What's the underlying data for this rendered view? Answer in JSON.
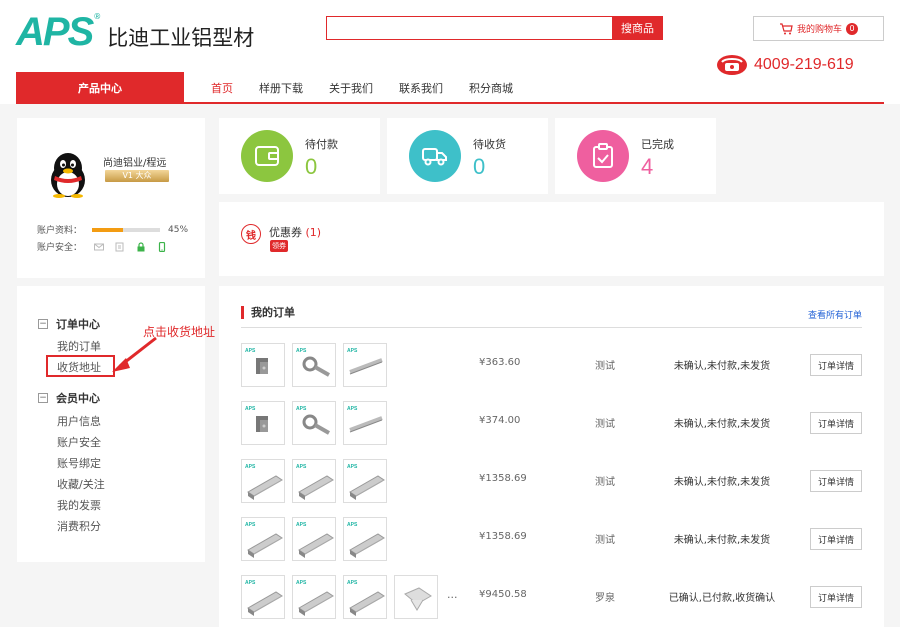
{
  "header": {
    "logo_mark": "APS",
    "logo_reg": "®",
    "logo_text": "比迪工业铝型材",
    "search_placeholder": "",
    "search_button": "搜商品",
    "cart_label": "我的购物车",
    "cart_count": "0",
    "phone": "4009-219-619"
  },
  "nav": {
    "product_center": "产品中心",
    "items": [
      "首页",
      "样册下载",
      "关于我们",
      "联系我们",
      "积分商城"
    ]
  },
  "profile": {
    "username": "尚迪铝业/程远",
    "vip_label": "V1 大众",
    "account_info_label": "账户资料：",
    "account_info_percent": "45%",
    "account_info_progress": 0.45,
    "account_security_label": "账户安全："
  },
  "stats": [
    {
      "label": "待付款",
      "value": "0",
      "color": "#8cc63f"
    },
    {
      "label": "待收货",
      "value": "0",
      "color": "#3ec0c9"
    },
    {
      "label": "已完成",
      "value": "4",
      "color": "#ef5f9f"
    }
  ],
  "coupon": {
    "icon_text": "钱",
    "label": "优惠券",
    "count": "(1)",
    "button": "领券"
  },
  "menu": {
    "order_center": "订单中心",
    "order_items": [
      "我的订单",
      "收货地址"
    ],
    "member_center": "会员中心",
    "member_items": [
      "用户信息",
      "账户安全",
      "账号绑定",
      "收藏/关注",
      "我的发票",
      "消费积分"
    ],
    "collapse_symbol": "−"
  },
  "annotation": "点击收货地址",
  "orders": {
    "title": "我的订单",
    "view_all": "查看所有订单",
    "detail_label": "订单详情",
    "rows": [
      {
        "price": "¥363.60",
        "note": "测试",
        "status": "未确认,未付款,未发货",
        "thumbs": [
          "bracket",
          "bolt",
          "strip"
        ],
        "more": ""
      },
      {
        "price": "¥374.00",
        "note": "测试",
        "status": "未确认,未付款,未发货",
        "thumbs": [
          "bracket",
          "bolt",
          "strip"
        ],
        "more": ""
      },
      {
        "price": "¥1358.69",
        "note": "测试",
        "status": "未确认,未付款,未发货",
        "thumbs": [
          "profile",
          "profile",
          "profile"
        ],
        "more": ""
      },
      {
        "price": "¥1358.69",
        "note": "测试",
        "status": "未确认,未付款,未发货",
        "thumbs": [
          "profile",
          "profile",
          "profile"
        ],
        "more": ""
      },
      {
        "price": "¥9450.58",
        "note": "罗泉",
        "status": "已确认,已付款,收货确认",
        "thumbs": [
          "profile",
          "profile",
          "profile",
          "plate"
        ],
        "more": "···"
      }
    ]
  }
}
